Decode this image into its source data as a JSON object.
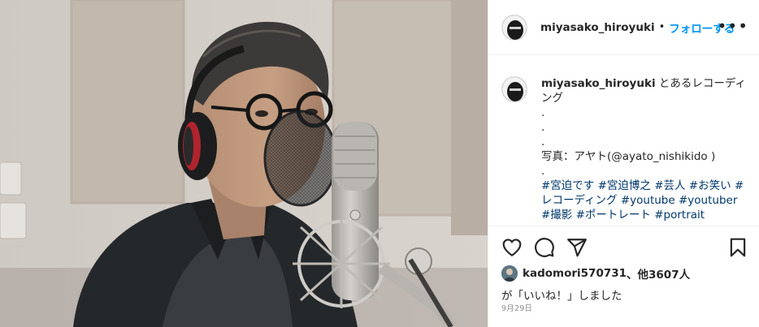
{
  "post": {
    "username": "miyasako_hiroyuki",
    "separator": "•",
    "follow_label": "フォローする",
    "more_label": "•••"
  },
  "caption": {
    "username": "miyasako_hiroyuki",
    "lines": [
      "とあるレコーディング",
      ".",
      ".",
      ".",
      "写真：アヤト(@ayato_nishikido )",
      "."
    ],
    "hashtags": "#宮迫です #宮迫博之 #芸人 #お笑い #レコーディング #youtube #youtuber #撮影 #ポートレート #portrait #tokyo"
  },
  "likes": {
    "liker": "kadomori570731",
    "others": "、他3607人",
    "suffix": "が「いいね！」しました"
  },
  "date": "9月29日",
  "icons": {
    "like": "heart-outline-icon",
    "comment": "speech-bubble-icon",
    "share": "paper-plane-icon",
    "save": "bookmark-icon"
  },
  "colors": {
    "link": "#0095f6",
    "hashtag": "#00376b",
    "text": "#262626",
    "muted": "#8e8e8e",
    "border": "#efefef"
  }
}
